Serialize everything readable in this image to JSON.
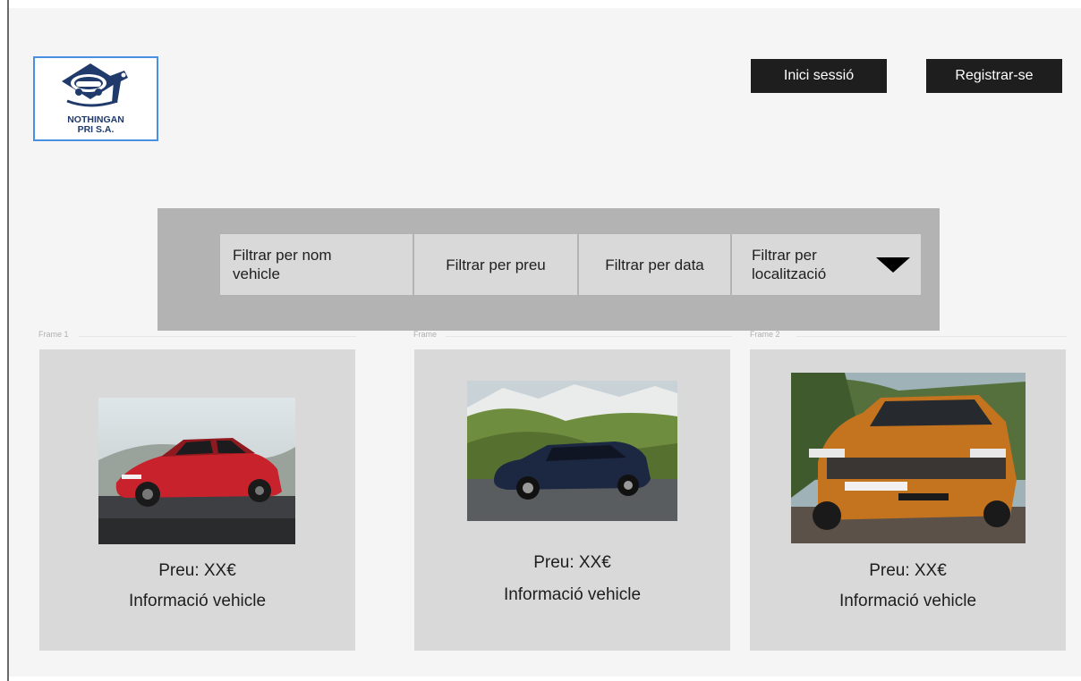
{
  "brand": {
    "name_line1": "NOTHINGAN",
    "name_line2": "PRI S.A."
  },
  "header": {
    "login_label": "Inici sessió",
    "register_label": "Registrar-se"
  },
  "filters": {
    "name_line1": "Filtrar per nom",
    "name_line2": "vehicle",
    "price": "Filtrar per preu",
    "date": "Filtrar per data",
    "location_line1": "Filtrar per",
    "location_line2": "localització"
  },
  "frames": [
    "Frame 1",
    "Frame",
    "Frame 2"
  ],
  "vehicles": [
    {
      "price": "Preu: XX€",
      "info": "Informació vehicle",
      "image": "red-hatchback-car",
      "color": "#c8222c"
    },
    {
      "price": "Preu: XX€",
      "info": "Informació vehicle",
      "image": "blue-estate-car",
      "color": "#1c2741"
    },
    {
      "price": "Preu: XX€",
      "info": "Informació vehicle",
      "image": "orange-crossover-suv",
      "color": "#c4741e"
    }
  ]
}
